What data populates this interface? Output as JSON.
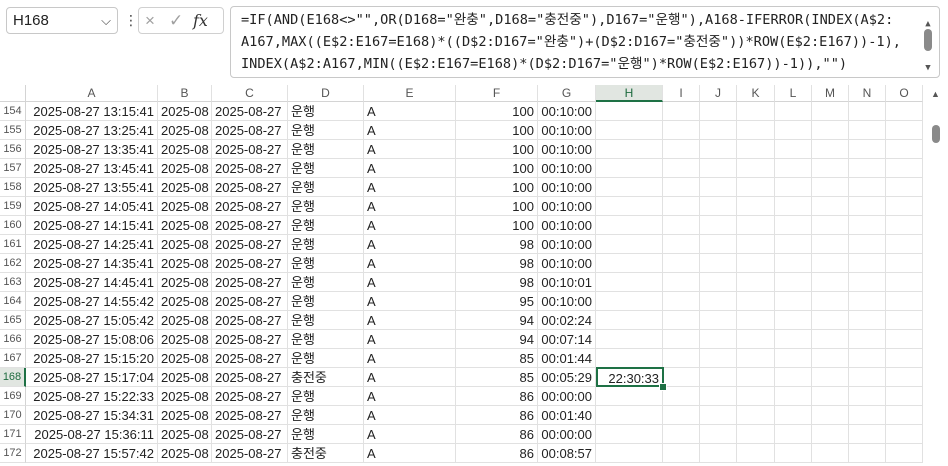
{
  "name_box": {
    "value": "H168"
  },
  "formula_bar": {
    "lines": [
      "=IF(AND(E168<>\"\",OR(D168=\"완충\",D168=\"충전중\"),D167=\"운행\"),A168-IFERROR(INDEX(A$2:",
      "A167,MAX((E$2:E167=E168)*((D$2:D167=\"완충\")+(D$2:D167=\"충전중\"))*ROW(E$2:E167))-1),",
      "INDEX(A$2:A167,MIN((E$2:E167=E168)*(D$2:D167=\"운행\")*ROW(E$2:E167))-1)),\"\")"
    ],
    "icons": {
      "cancel": "×",
      "enter": "✓",
      "fx": "fx",
      "more": "⋮",
      "dropdown": "⌵"
    }
  },
  "columns": [
    "A",
    "B",
    "C",
    "D",
    "E",
    "F",
    "G",
    "H",
    "I",
    "J",
    "K",
    "L",
    "M",
    "N",
    "O"
  ],
  "active_cell": {
    "row": "168",
    "col": "H",
    "value": "22:30:33"
  },
  "rows": [
    {
      "num": "154",
      "a": "2025-08-27 13:15:41",
      "b": "2025-08",
      "c": "2025-08-27",
      "d": "운행",
      "e": "A",
      "f": "100",
      "g": "00:10:00",
      "h": ""
    },
    {
      "num": "155",
      "a": "2025-08-27 13:25:41",
      "b": "2025-08",
      "c": "2025-08-27",
      "d": "운행",
      "e": "A",
      "f": "100",
      "g": "00:10:00",
      "h": ""
    },
    {
      "num": "156",
      "a": "2025-08-27 13:35:41",
      "b": "2025-08",
      "c": "2025-08-27",
      "d": "운행",
      "e": "A",
      "f": "100",
      "g": "00:10:00",
      "h": ""
    },
    {
      "num": "157",
      "a": "2025-08-27 13:45:41",
      "b": "2025-08",
      "c": "2025-08-27",
      "d": "운행",
      "e": "A",
      "f": "100",
      "g": "00:10:00",
      "h": ""
    },
    {
      "num": "158",
      "a": "2025-08-27 13:55:41",
      "b": "2025-08",
      "c": "2025-08-27",
      "d": "운행",
      "e": "A",
      "f": "100",
      "g": "00:10:00",
      "h": ""
    },
    {
      "num": "159",
      "a": "2025-08-27 14:05:41",
      "b": "2025-08",
      "c": "2025-08-27",
      "d": "운행",
      "e": "A",
      "f": "100",
      "g": "00:10:00",
      "h": ""
    },
    {
      "num": "160",
      "a": "2025-08-27 14:15:41",
      "b": "2025-08",
      "c": "2025-08-27",
      "d": "운행",
      "e": "A",
      "f": "100",
      "g": "00:10:00",
      "h": ""
    },
    {
      "num": "161",
      "a": "2025-08-27 14:25:41",
      "b": "2025-08",
      "c": "2025-08-27",
      "d": "운행",
      "e": "A",
      "f": "98",
      "g": "00:10:00",
      "h": ""
    },
    {
      "num": "162",
      "a": "2025-08-27 14:35:41",
      "b": "2025-08",
      "c": "2025-08-27",
      "d": "운행",
      "e": "A",
      "f": "98",
      "g": "00:10:00",
      "h": ""
    },
    {
      "num": "163",
      "a": "2025-08-27 14:45:41",
      "b": "2025-08",
      "c": "2025-08-27",
      "d": "운행",
      "e": "A",
      "f": "98",
      "g": "00:10:01",
      "h": ""
    },
    {
      "num": "164",
      "a": "2025-08-27 14:55:42",
      "b": "2025-08",
      "c": "2025-08-27",
      "d": "운행",
      "e": "A",
      "f": "95",
      "g": "00:10:00",
      "h": ""
    },
    {
      "num": "165",
      "a": "2025-08-27 15:05:42",
      "b": "2025-08",
      "c": "2025-08-27",
      "d": "운행",
      "e": "A",
      "f": "94",
      "g": "00:02:24",
      "h": ""
    },
    {
      "num": "166",
      "a": "2025-08-27 15:08:06",
      "b": "2025-08",
      "c": "2025-08-27",
      "d": "운행",
      "e": "A",
      "f": "94",
      "g": "00:07:14",
      "h": ""
    },
    {
      "num": "167",
      "a": "2025-08-27 15:15:20",
      "b": "2025-08",
      "c": "2025-08-27",
      "d": "운행",
      "e": "A",
      "f": "85",
      "g": "00:01:44",
      "h": ""
    },
    {
      "num": "168",
      "a": "2025-08-27 15:17:04",
      "b": "2025-08",
      "c": "2025-08-27",
      "d": "충전중",
      "e": "A",
      "f": "85",
      "g": "00:05:29",
      "h": "22:30:33"
    },
    {
      "num": "169",
      "a": "2025-08-27 15:22:33",
      "b": "2025-08",
      "c": "2025-08-27",
      "d": "운행",
      "e": "A",
      "f": "86",
      "g": "00:00:00",
      "h": ""
    },
    {
      "num": "170",
      "a": "2025-08-27 15:34:31",
      "b": "2025-08",
      "c": "2025-08-27",
      "d": "운행",
      "e": "A",
      "f": "86",
      "g": "00:01:40",
      "h": ""
    },
    {
      "num": "171",
      "a": "2025-08-27 15:36:11",
      "b": "2025-08",
      "c": "2025-08-27",
      "d": "운행",
      "e": "A",
      "f": "86",
      "g": "00:00:00",
      "h": ""
    },
    {
      "num": "172",
      "a": "2025-08-27 15:57:42",
      "b": "2025-08",
      "c": "2025-08-27",
      "d": "충전중",
      "e": "A",
      "f": "86",
      "g": "00:08:57",
      "h": ""
    }
  ],
  "colors": {
    "accent": "#1e7145"
  }
}
